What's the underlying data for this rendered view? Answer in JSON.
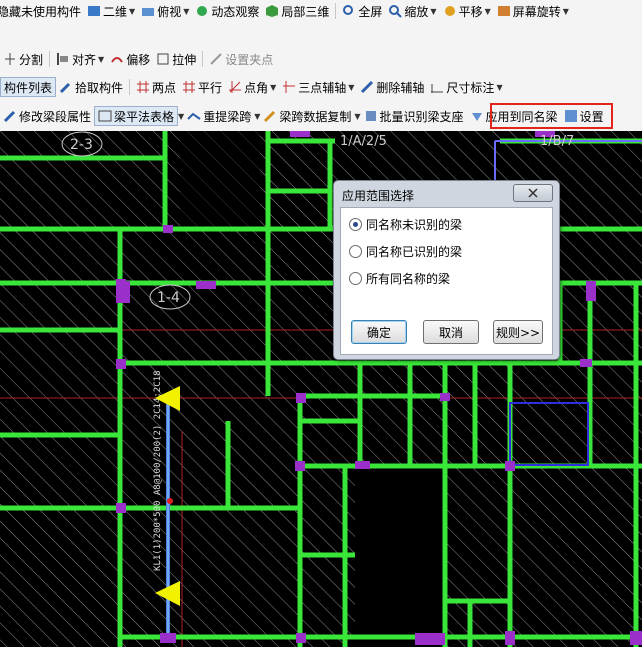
{
  "toolbar_row1": {
    "item1": "隐藏未使用构件",
    "item2": "二维",
    "item3": "俯视",
    "item4": "动态观察",
    "item5": "局部三维",
    "item6": "全屏",
    "item7": "缩放",
    "item8": "平移",
    "item9": "屏幕旋转"
  },
  "toolbar_row2": {
    "split": "分割",
    "align": "对齐",
    "offset": "偏移",
    "stretch": "拉伸",
    "set_point": "设置夹点"
  },
  "toolbar_row3": {
    "component_list": "构件列表",
    "pick_component": "拾取构件",
    "two_points": "两点",
    "parallel": "平行",
    "point_angle": "点角",
    "three_point_axis": "三点辅轴",
    "delete_axis": "删除辅轴",
    "dimension": "尺寸标注"
  },
  "toolbar_row4": {
    "modify_segment": "修改梁段属性",
    "beam_table": "梁平法表格",
    "re_span": "重提梁跨",
    "span_copy": "梁跨数据复制",
    "batch_support": "批量识别梁支座",
    "apply_same": "应用到同名梁",
    "settings": "设置"
  },
  "cad": {
    "label_2_3": "2-3",
    "label_1_4": "1-4",
    "label_top_mid": "1/A/2/5",
    "label_top_right": "1/B/7",
    "beam_text": "KL1(1)200*500 A8@100/200(2) 2C14;2C18"
  },
  "dialog": {
    "title": "应用范围选择",
    "options": [
      "同名称未识别的梁",
      "同名称已识别的梁",
      "所有同名称的梁"
    ],
    "selected_index": 0,
    "ok": "确定",
    "cancel": "取消",
    "rules": "规则>>"
  },
  "colors": {
    "beam": "#39e639",
    "column": "#9b2fc9",
    "highlight": "#e1251b",
    "yellow_marker": "#f2f200"
  }
}
